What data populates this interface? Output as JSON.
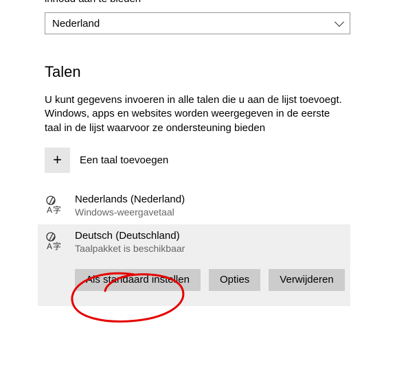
{
  "top_truncated": "inhoud aan te bieden",
  "region_select": "Nederland",
  "section_title": "Talen",
  "section_desc": "U kunt gegevens invoeren in alle talen die u aan de lijst toevoegt. Windows, apps en websites worden weergegeven in de eerste taal in de lijst waarvoor ze ondersteuning bieden",
  "add_language": "Een taal toevoegen",
  "languages": [
    {
      "name": "Nederlands (Nederland)",
      "sub": "Windows-weergavetaal"
    },
    {
      "name": "Deutsch (Deutschland)",
      "sub": "Taalpakket is beschikbaar"
    }
  ],
  "buttons": {
    "set_default": "Als standaard instellen",
    "options": "Opties",
    "remove": "Verwijderen"
  }
}
